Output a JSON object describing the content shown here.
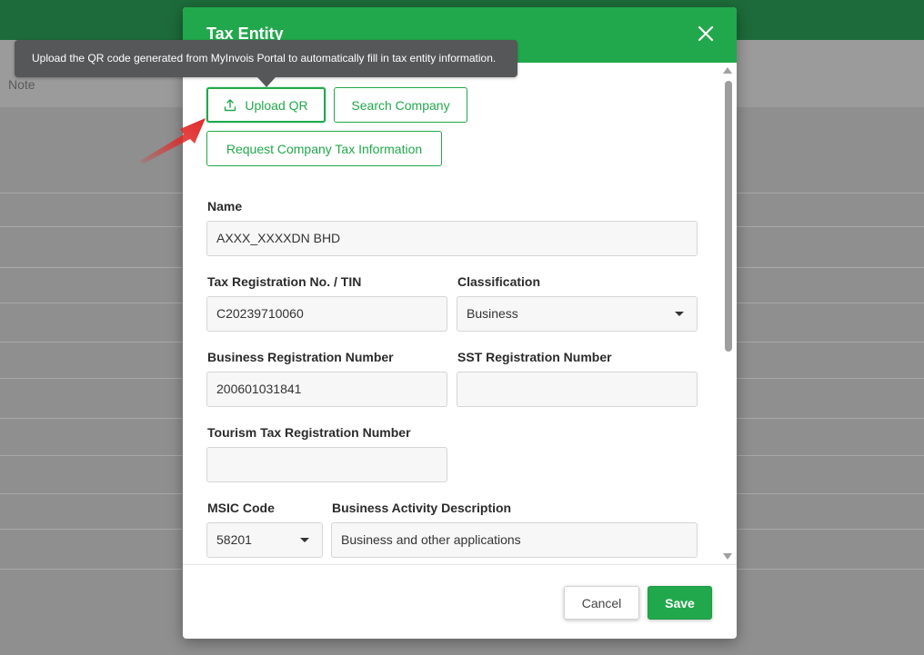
{
  "background": {
    "note_label": "Note"
  },
  "tooltip": {
    "text": "Upload the QR code generated from MyInvois Portal to automatically fill in tax entity information."
  },
  "modal": {
    "title": "Tax Entity",
    "close_icon": "close-icon",
    "actions": {
      "upload_qr": "Upload QR",
      "upload_icon": "upload-icon",
      "search_company": "Search Company",
      "request_tax_info": "Request Company Tax Information"
    },
    "form": {
      "name_label": "Name",
      "name_value": "AXXX_XXXXDN BHD",
      "tin_label": "Tax Registration No. / TIN",
      "tin_value": "C20239710060",
      "classification_label": "Classification",
      "classification_value": "Business",
      "brn_label": "Business Registration Number",
      "brn_value": "200601031841",
      "sst_label": "SST Registration Number",
      "sst_value": "",
      "tourism_label": "Tourism Tax Registration Number",
      "tourism_value": "",
      "msic_label": "MSIC Code",
      "msic_value": "58201",
      "activity_label": "Business Activity Description",
      "activity_value": "Business and other applications"
    },
    "footer": {
      "cancel": "Cancel",
      "save": "Save"
    }
  },
  "colors": {
    "accent": "#22a84c",
    "pointer": "#e02a2a",
    "tooltip_bg": "#555759"
  }
}
